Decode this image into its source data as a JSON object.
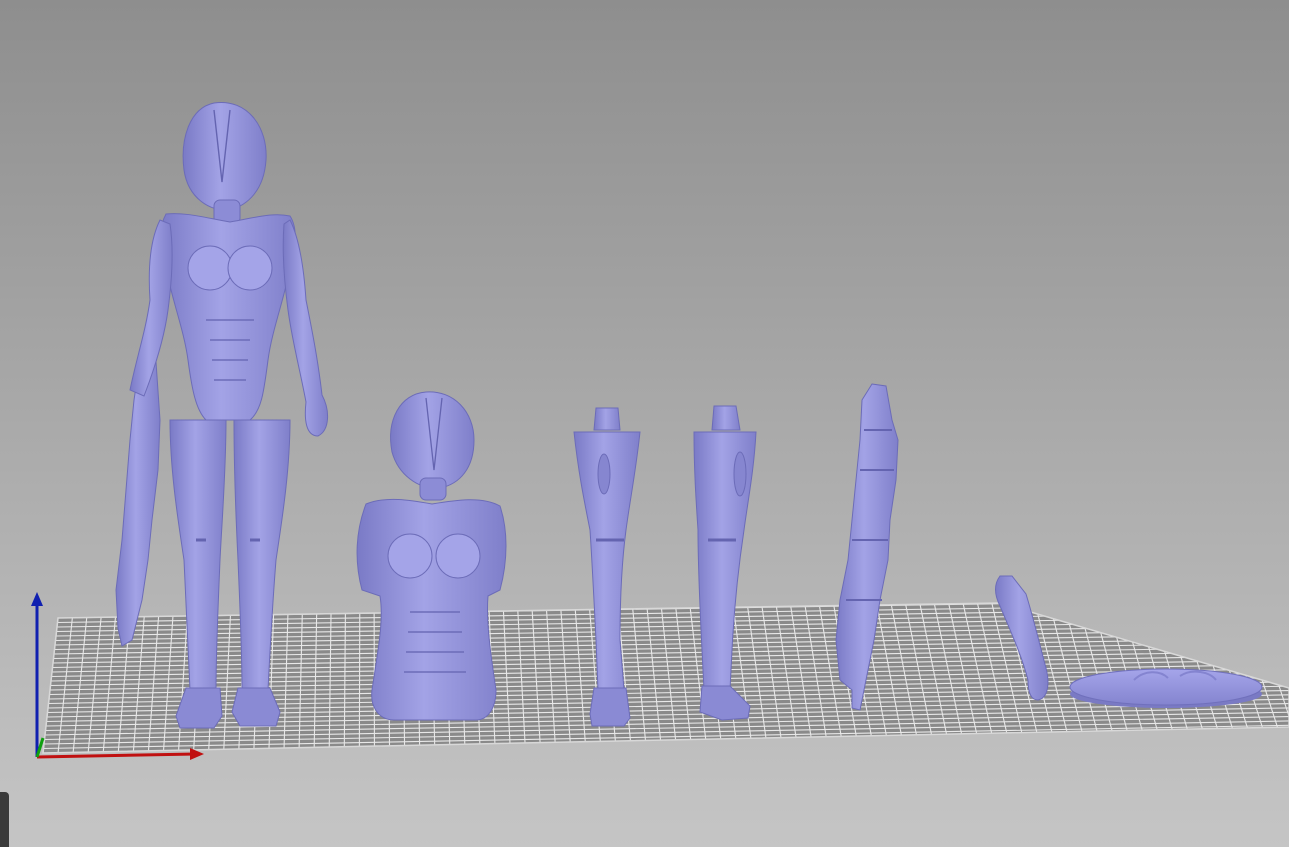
{
  "viewport": {
    "kind": "3d-printing-slicer-plater",
    "background_top": "#8e8e8e",
    "background_bottom": "#c5c5c5",
    "bed_color": "#8a8a8a",
    "grid_color": "#e8e8e8",
    "model_color": "#9b9be0",
    "model_shade": "#7a7ac6",
    "model_highlight": "#b8b8f0"
  },
  "axes": {
    "x_color": "#c01010",
    "y_color": "#10a010",
    "z_color": "#1020b0"
  },
  "objects": [
    {
      "id": "full-figure",
      "icon": "figure-with-rifle"
    },
    {
      "id": "torso-with-helmet",
      "icon": "bust"
    },
    {
      "id": "left-leg",
      "icon": "leg"
    },
    {
      "id": "right-leg",
      "icon": "leg"
    },
    {
      "id": "rifle",
      "icon": "rifle"
    },
    {
      "id": "arm",
      "icon": "arm"
    },
    {
      "id": "base",
      "icon": "round-base"
    }
  ]
}
